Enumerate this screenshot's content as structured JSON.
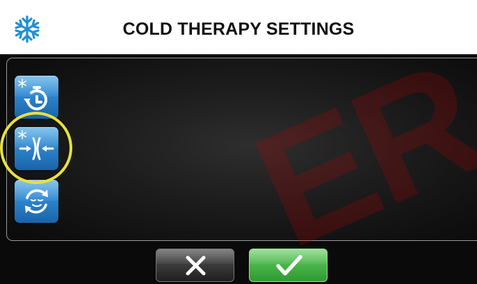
{
  "header": {
    "title": "COLD THERAPY SETTINGS",
    "icon": "snowflake-icon"
  },
  "modes": [
    {
      "icon": "cold-timer-icon",
      "selected": false
    },
    {
      "icon": "cold-compression-icon",
      "selected": true
    },
    {
      "icon": "cold-relax-cycle-icon",
      "selected": false
    }
  ],
  "footer": {
    "cancel_icon": "close-icon",
    "confirm_icon": "checkmark-icon"
  },
  "watermark": {
    "text": "ER"
  },
  "colors": {
    "accent_blue": "#2d86cf",
    "confirm_green": "#48b449",
    "highlight_yellow": "#e8e23a",
    "watermark_red": "#be0000"
  }
}
